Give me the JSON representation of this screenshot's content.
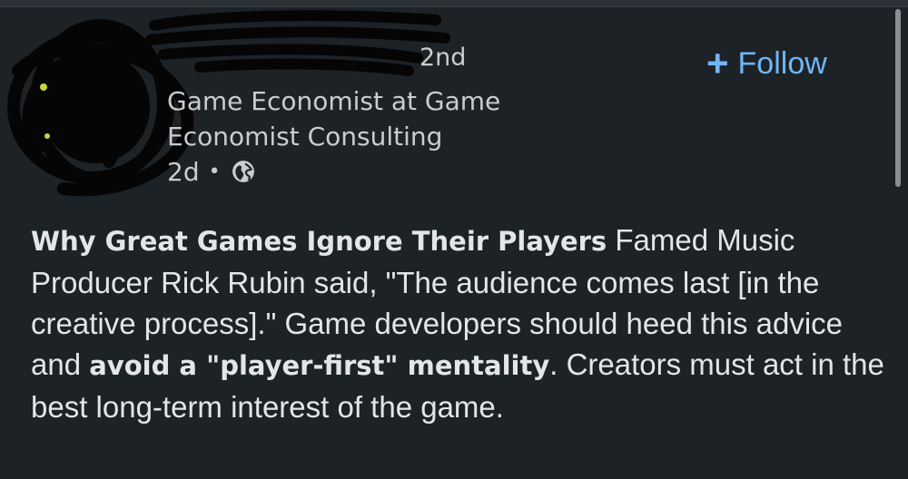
{
  "author": {
    "degree": "2nd",
    "headline": "Game Economist at Game Economist Consulting",
    "time_ago": "2d",
    "separator": "•",
    "visibility_icon": "globe-icon"
  },
  "follow": {
    "plus": "+",
    "label": "Follow"
  },
  "post": {
    "title": "Why Great Games Ignore Their Players",
    "text_1": " Famed Music Producer Rick Rubin said, \"The audience comes last [in the creative process].\" Game developers should heed this advice and ",
    "bold_2": "avoid a \"player-first\" mentality",
    "text_3": ". Creators must act in the best long-term interest of the game."
  },
  "colors": {
    "background": "#1d2226",
    "text": "#e3e5e8",
    "accent": "#70b5f9"
  }
}
